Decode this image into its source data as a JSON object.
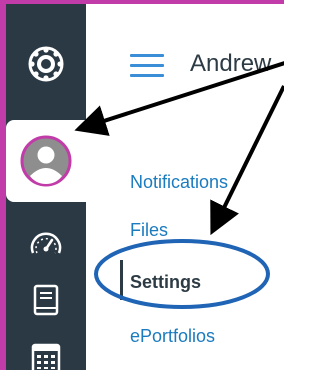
{
  "colors": {
    "accent_border": "#c13ca8",
    "rail_bg": "#2b3944",
    "link": "#1a7bbf",
    "annotation_arrow": "#000000",
    "annotation_circle": "#1f64b5"
  },
  "rail": {
    "items": [
      {
        "icon": "canvas-logo-icon"
      },
      {
        "icon": "account-avatar-icon",
        "active": true
      },
      {
        "icon": "dashboard-gauge-icon"
      },
      {
        "icon": "courses-book-icon"
      },
      {
        "icon": "calendar-icon"
      }
    ]
  },
  "header": {
    "menu_icon": "hamburger-menu-icon",
    "user_name": "Andrew"
  },
  "account_menu": {
    "items": [
      {
        "label": "Notifications"
      },
      {
        "label": "Files"
      },
      {
        "label": "Settings",
        "active": true
      },
      {
        "label": "ePortfolios"
      }
    ]
  }
}
